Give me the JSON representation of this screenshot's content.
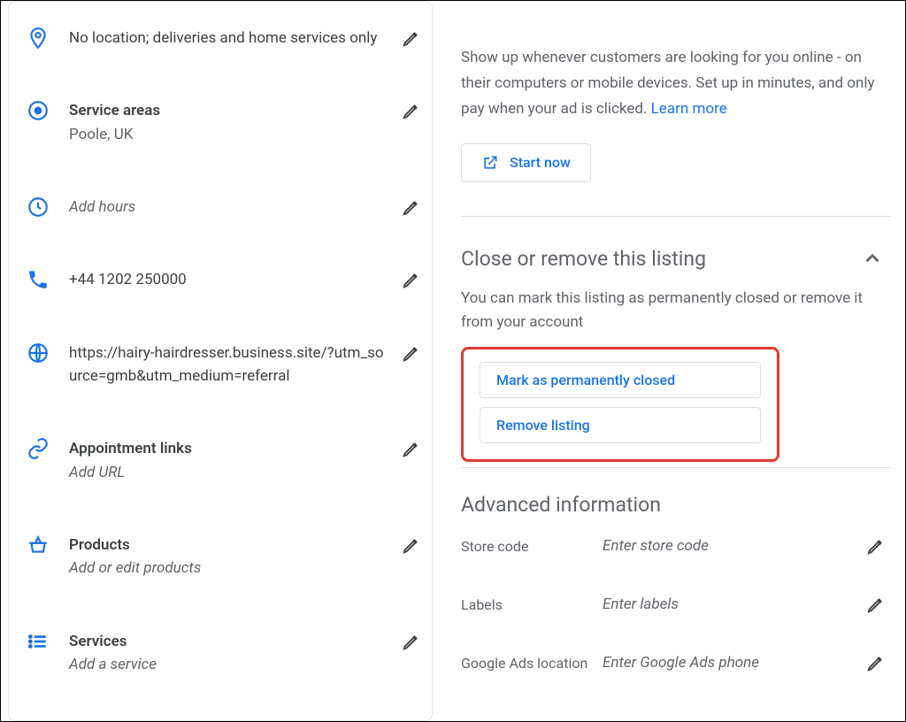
{
  "left": {
    "location": {
      "text": "No location; deliveries and home services only"
    },
    "service_areas": {
      "heading": "Service areas",
      "sub": "Poole, UK"
    },
    "hours": {
      "text": "Add hours"
    },
    "phone": {
      "text": "+44 1202 250000"
    },
    "website": {
      "text": "https://hairy-hairdresser.business.site/?utm_source=gmb&utm_medium=referral"
    },
    "appointment": {
      "heading": "Appointment links",
      "sub": "Add URL"
    },
    "products": {
      "heading": "Products",
      "sub": "Add or edit products"
    },
    "services": {
      "heading": "Services",
      "sub": "Add a service"
    }
  },
  "right": {
    "promo": {
      "text": "Show up whenever customers are looking for you online - on their computers or mobile devices. Set up in minutes, and only pay when your ad is clicked. ",
      "learn": "Learn more",
      "cta": "Start now"
    },
    "close_section": {
      "title": "Close or remove this listing",
      "desc": "You can mark this listing as permanently closed or remove it from your account",
      "btn1": "Mark as permanently closed",
      "btn2": "Remove listing"
    },
    "advanced": {
      "title": "Advanced information",
      "rows": [
        {
          "label": "Store code",
          "value": "Enter store code"
        },
        {
          "label": "Labels",
          "value": "Enter labels"
        },
        {
          "label": "Google Ads location",
          "value": "Enter Google Ads phone"
        }
      ]
    }
  }
}
